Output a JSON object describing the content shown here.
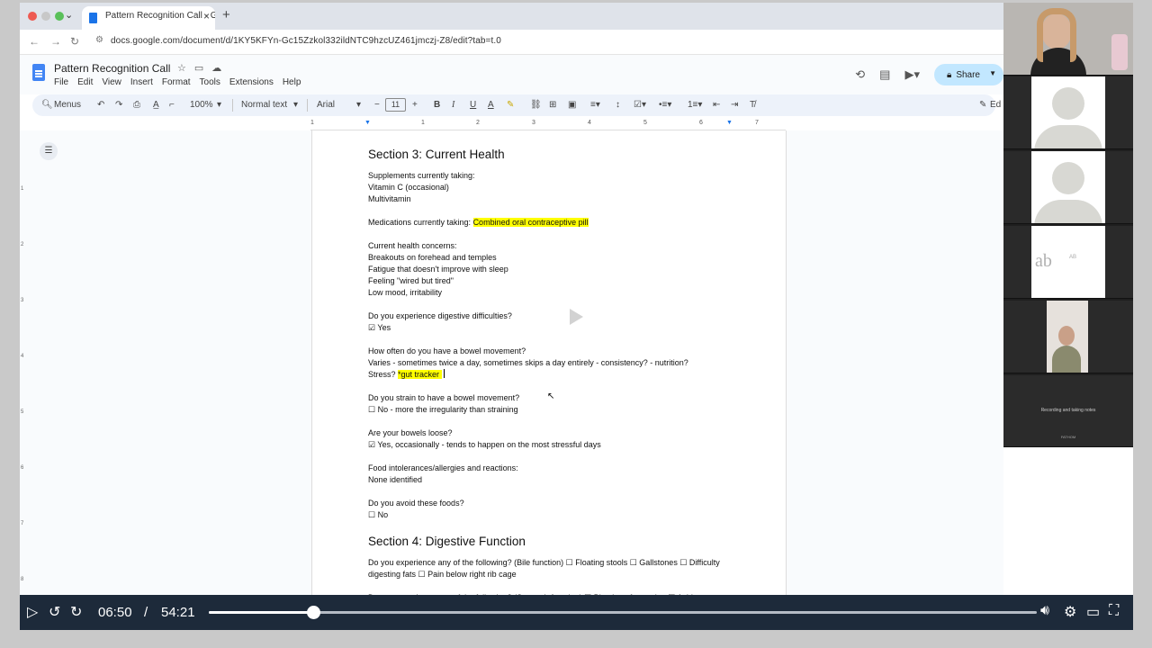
{
  "browser": {
    "tab_title": "Pattern Recognition Call - Go",
    "url": "docs.google.com/document/d/1KY5KFYn-Gc15Zzkol332ildNTC9hzcUZ461jmczj-Z8/edit?tab=t.0"
  },
  "docs": {
    "title": "Pattern Recognition Call",
    "menu": [
      "File",
      "Edit",
      "View",
      "Insert",
      "Format",
      "Tools",
      "Extensions",
      "Help"
    ],
    "share_label": "Share",
    "toolbar": {
      "menus_label": "Menus",
      "zoom": "100%",
      "style": "Normal text",
      "font": "Arial",
      "font_size": "11",
      "edit_label": "Ed"
    },
    "ruler_marks": [
      "1",
      "1",
      "2",
      "3",
      "4",
      "5",
      "6",
      "7"
    ],
    "vruler_marks": [
      "1",
      "2",
      "3",
      "4",
      "5",
      "6",
      "7",
      "8"
    ]
  },
  "document": {
    "section3_heading": "Section 3: Current Health",
    "supplements_label": "Supplements currently taking:",
    "supplement_1": "Vitamin C (occasional)",
    "supplement_2": "Multivitamin",
    "medications_label": "Medications currently taking: ",
    "medications_value": "Combined oral contraceptive pill",
    "concerns_label": "Current health concerns:",
    "concern_1": "Breakouts on forehead and temples",
    "concern_2": "Fatigue that doesn't improve with sleep",
    "concern_3": "Feeling \"wired but tired\"",
    "concern_4": "Low mood, irritability",
    "digestive_q": "Do you experience digestive difficulties?",
    "digestive_a": "☑ Yes",
    "bowel_q": "How often do you have a bowel movement?",
    "bowel_a": "Varies - sometimes twice a day, sometimes skips a day entirely - consistency? - nutrition?",
    "stress_prefix": "Stress? ",
    "stress_note": "*gut tracker ",
    "strain_q": "Do you strain to have a bowel movement?",
    "strain_a": "☐ No - more the irregularity than straining",
    "loose_q": "Are your bowels loose?",
    "loose_a": "☑ Yes, occasionally - tends to happen on the most stressful days",
    "food_q": "Food intolerances/allergies and reactions:",
    "food_a": "None identified",
    "avoid_q": "Do you avoid these foods?",
    "avoid_a": "☐ No",
    "section4_heading": "Section 4: Digestive Function",
    "bile_line": "Do you experience any of the following? (Bile function) ☐ Floating stools ☐ Gallstones ☐ Difficulty digesting fats ☐ Pain below right rib cage",
    "stomach_line": "Do you experience any of the following? (Stomach function) ☑ Bloating after eating ☑ Acid"
  },
  "participants": {
    "logo_text": "ab",
    "logo_sub": "AB",
    "recording_text": "Recording and taking notes",
    "recording_sub": "FATHOM"
  },
  "player": {
    "current_time": "06:50",
    "separator": "/",
    "duration": "54:21",
    "progress_fraction": 0.1257
  },
  "colors": {
    "highlight": "#ffff00",
    "share_bg": "#c2e7ff",
    "controls_bg": "#1d2a3a"
  }
}
